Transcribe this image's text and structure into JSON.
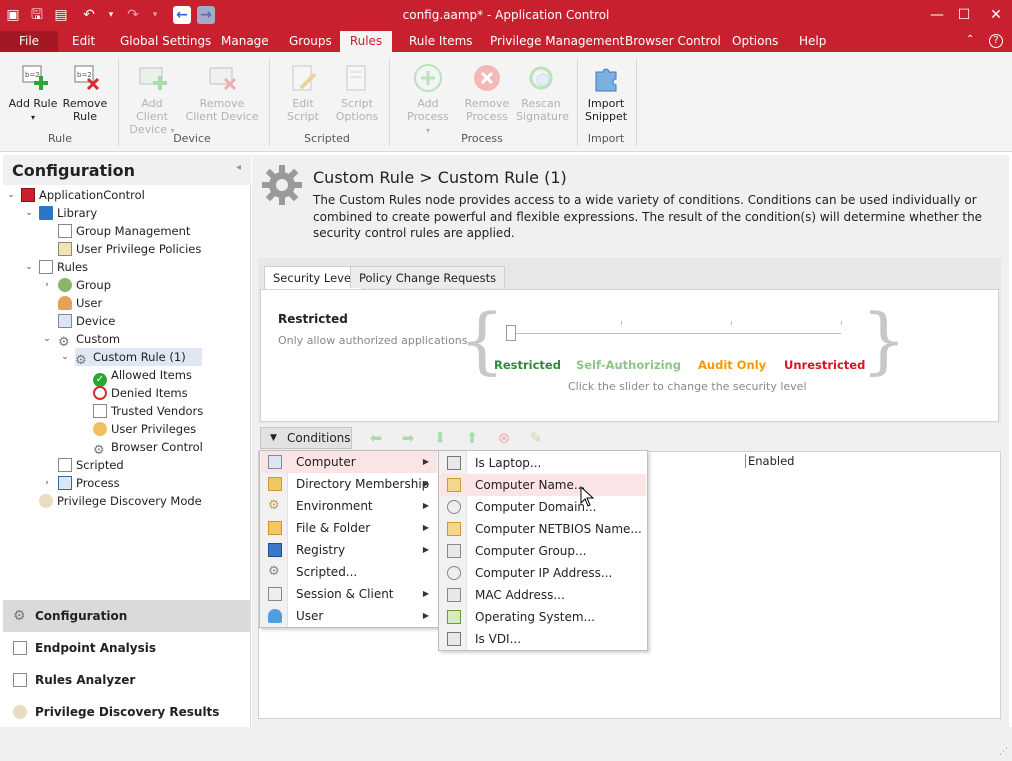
{
  "window": {
    "title": "config.aamp* - Application Control",
    "controls": {
      "minimize": "—",
      "maximize": "☐",
      "close": "✕"
    }
  },
  "menubar": {
    "items": [
      "File",
      "Edit",
      "Global Settings",
      "Manage",
      "Groups",
      "Rules",
      "Rule Items",
      "Privilege Management",
      "Browser Control",
      "Options",
      "Help"
    ],
    "active": "Rules"
  },
  "ribbon": {
    "groups": [
      {
        "label": "Rule",
        "buttons": [
          {
            "label": "Add Rule",
            "icon": "add-rule-icon",
            "enabled": true
          },
          {
            "label": "Remove Rule",
            "icon": "remove-rule-icon",
            "enabled": true
          }
        ]
      },
      {
        "label": "Device",
        "buttons": [
          {
            "label": "Add Client Device",
            "icon": "add-device-icon",
            "enabled": false
          },
          {
            "label": "Remove Client Device",
            "icon": "remove-device-icon",
            "enabled": false
          }
        ]
      },
      {
        "label": "Scripted",
        "buttons": [
          {
            "label": "Edit Script",
            "icon": "edit-script-icon",
            "enabled": false
          },
          {
            "label": "Script Options",
            "icon": "script-options-icon",
            "enabled": false
          }
        ]
      },
      {
        "label": "Process",
        "buttons": [
          {
            "label": "Add Process",
            "icon": "add-process-icon",
            "enabled": false
          },
          {
            "label": "Remove Process",
            "icon": "remove-process-icon",
            "enabled": false
          },
          {
            "label": "Rescan Signature",
            "icon": "rescan-icon",
            "enabled": false
          }
        ]
      },
      {
        "label": "Import",
        "buttons": [
          {
            "label": "Import Snippet",
            "icon": "puzzle-icon",
            "enabled": true
          }
        ]
      }
    ]
  },
  "leftpanel": {
    "title": "Configuration",
    "tree": [
      {
        "label": "ApplicationControl",
        "icon": "app-control-icon"
      },
      {
        "label": "Library",
        "icon": "library-icon"
      },
      {
        "label": "Group Management",
        "icon": "group-management-icon"
      },
      {
        "label": "User Privilege Policies",
        "icon": "user-privilege-policies-icon"
      },
      {
        "label": "Rules",
        "icon": "rules-icon"
      },
      {
        "label": "Group",
        "icon": "group-icon"
      },
      {
        "label": "User",
        "icon": "user-icon"
      },
      {
        "label": "Device",
        "icon": "device-icon"
      },
      {
        "label": "Custom",
        "icon": "custom-gear-icon"
      },
      {
        "label": "Custom Rule (1)",
        "icon": "custom-rule-gear-icon"
      },
      {
        "label": "Allowed Items",
        "icon": "allowed-check-icon"
      },
      {
        "label": "Denied Items",
        "icon": "denied-icon"
      },
      {
        "label": "Trusted Vendors",
        "icon": "trusted-vendors-icon"
      },
      {
        "label": "User Privileges",
        "icon": "user-privileges-icon"
      },
      {
        "label": "Browser Control",
        "icon": "browser-control-icon"
      },
      {
        "label": "Scripted",
        "icon": "scripted-icon"
      },
      {
        "label": "Process",
        "icon": "process-icon"
      },
      {
        "label": "Privilege Discovery Mode",
        "icon": "privilege-discovery-icon"
      }
    ],
    "nav": [
      {
        "label": "Configuration",
        "active": true
      },
      {
        "label": "Endpoint Analysis",
        "active": false
      },
      {
        "label": "Rules Analyzer",
        "active": false
      },
      {
        "label": "Privilege Discovery Results",
        "active": false
      }
    ]
  },
  "main": {
    "breadcrumb": "Custom Rule > Custom Rule (1)",
    "description": "The Custom Rules node provides access to a wide variety of conditions. Conditions can be used individually or combined to create powerful and flexible expressions. The result of the condition(s) will determine whether the security control rules are applied.",
    "tabs": [
      "Security Level",
      "Policy Change Requests"
    ],
    "security": {
      "current_title": "Restricted",
      "current_desc": "Only allow authorized applications",
      "levels": [
        {
          "label": "Restricted",
          "color": "#2e8b3a"
        },
        {
          "label": "Self-Authorizing",
          "color": "#8fc38a"
        },
        {
          "label": "Audit Only",
          "color": "#f59a00"
        },
        {
          "label": "Unrestricted",
          "color": "#d8141e"
        }
      ],
      "hint": "Click the slider to change the security level"
    },
    "conditions_button": "Conditions",
    "grid_column": "Enabled"
  },
  "conditions_menu": {
    "items": [
      "Computer",
      "Directory Membership",
      "Environment",
      "File & Folder",
      "Registry",
      "Scripted...",
      "Session & Client",
      "User"
    ],
    "hover": "Computer"
  },
  "computer_submenu": {
    "items": [
      "Is Laptop...",
      "Computer Name...",
      "Computer Domain...",
      "Computer NETBIOS Name...",
      "Computer Group...",
      "Computer IP Address...",
      "MAC Address...",
      "Operating System...",
      "Is VDI..."
    ],
    "hover": "Computer Name..."
  }
}
